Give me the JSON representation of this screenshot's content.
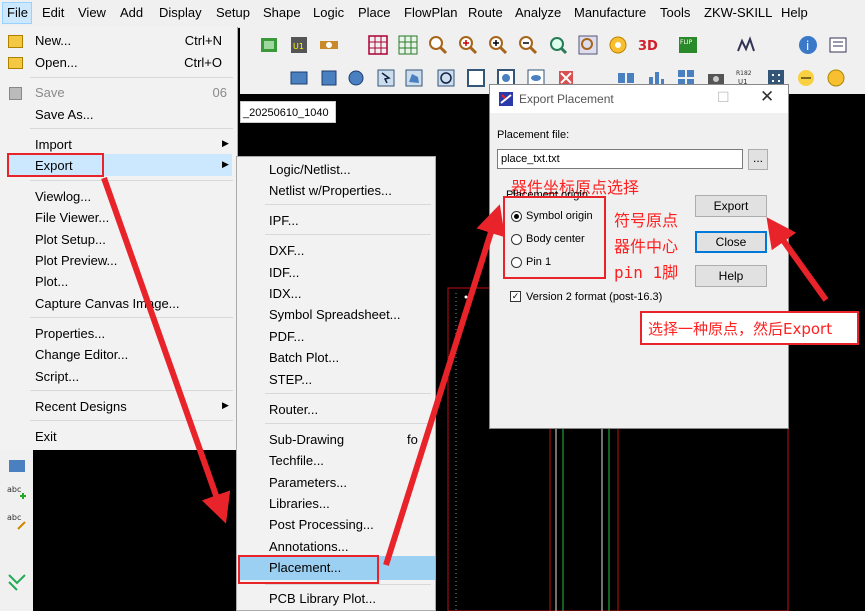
{
  "menubar": {
    "items": [
      "File",
      "Edit",
      "View",
      "Add",
      "Display",
      "Setup",
      "Shape",
      "Logic",
      "Place",
      "FlowPlan",
      "Route",
      "Analyze",
      "Manufacture",
      "Tools",
      "ZKW-SKILL",
      "Help"
    ]
  },
  "tab": {
    "label": "_20250610_1040"
  },
  "file_menu": {
    "new": {
      "label": "New...",
      "shortcut": "Ctrl+N"
    },
    "open": {
      "label": "Open...",
      "shortcut": "Ctrl+O"
    },
    "save": {
      "label": "Save",
      "shortcut": "06"
    },
    "save_as": {
      "label": "Save As..."
    },
    "import": {
      "label": "Import"
    },
    "export": {
      "label": "Export"
    },
    "viewlog": {
      "label": "Viewlog..."
    },
    "file_viewer": {
      "label": "File Viewer..."
    },
    "plot_setup": {
      "label": "Plot Setup..."
    },
    "plot_preview": {
      "label": "Plot Preview..."
    },
    "plot": {
      "label": "Plot..."
    },
    "capture": {
      "label": "Capture Canvas Image..."
    },
    "properties": {
      "label": "Properties..."
    },
    "change_editor": {
      "label": "Change Editor..."
    },
    "script": {
      "label": "Script..."
    },
    "recent": {
      "label": "Recent Designs"
    },
    "exit": {
      "label": "Exit"
    }
  },
  "export_menu": {
    "items": [
      "Logic/Netlist...",
      "Netlist w/Properties...",
      "IPF...",
      "DXF...",
      "IDF...",
      "IDX...",
      "Symbol Spreadsheet...",
      "PDF...",
      "Batch Plot...",
      "STEP...",
      "Router...",
      "Sub-Drawing",
      "Techfile...",
      "Parameters...",
      "Libraries...",
      "Post Processing...",
      "Annotations...",
      "Placement...",
      "PCB Library Plot..."
    ],
    "subdrawing_suffix": "fo"
  },
  "dialog": {
    "title": "Export Placement",
    "file_label": "Placement file:",
    "file_value": "place_txt.txt",
    "browse_label": "...",
    "origin_group": "Placement origin",
    "options": [
      "Symbol origin",
      "Body center",
      "Pin 1"
    ],
    "selected": 0,
    "version_label": "Version 2 format (post-16.3)",
    "version_checked": true,
    "export_btn": "Export",
    "close_btn": "Close",
    "help_btn": "Help"
  },
  "annotations": {
    "title_cn": "器件坐标原点选择",
    "opt1_cn": "符号原点",
    "opt2_cn": "器件中心",
    "opt3_cn": "pin 1脚",
    "instruction": "选择一种原点，然后Export"
  },
  "colors": {
    "accent_red": "#e8232a",
    "highlight": "#9bd0f2",
    "menu_bg": "#f2f2f2"
  }
}
